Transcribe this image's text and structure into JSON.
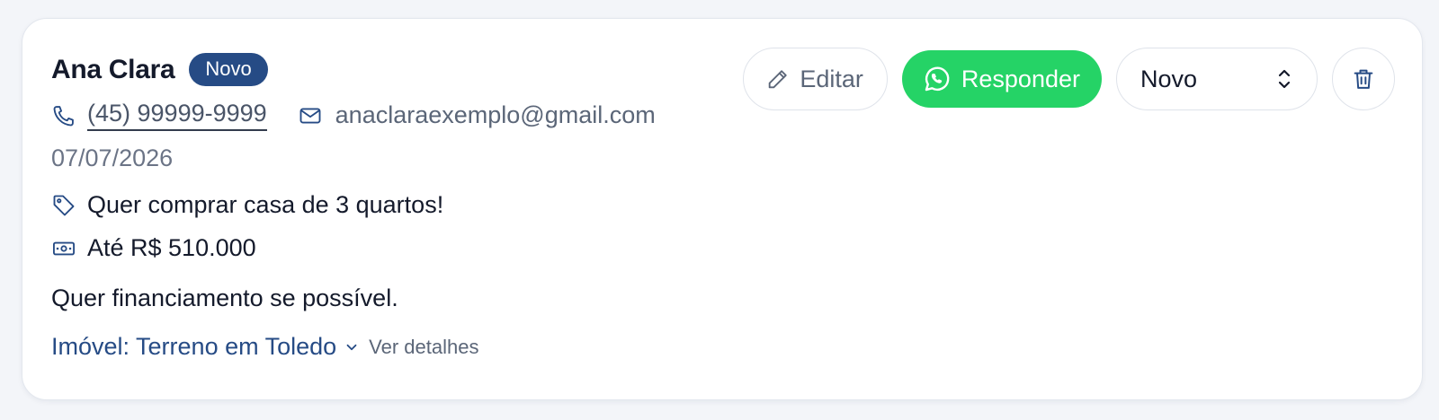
{
  "lead": {
    "name": "Ana Clara",
    "badge": "Novo",
    "phone": "(45) 99999-9999",
    "email": "anaclaraexemplo@gmail.com",
    "date": "07/07/2026",
    "interest": "Quer comprar casa de 3 quartos!",
    "budget": "Até R$ 510.000",
    "notes": "Quer financiamento se possível.",
    "property": "Imóvel: Terreno em Toledo",
    "details_label": "Ver detalhes"
  },
  "actions": {
    "edit_label": "Editar",
    "reply_label": "Responder",
    "status_value": "Novo"
  },
  "icons": {
    "phone": "phone-icon",
    "email": "mail-icon",
    "tag": "tag-icon",
    "money": "banknote-icon",
    "chevron": "chevron-down-icon",
    "edit": "pencil-icon",
    "reply": "whatsapp-icon",
    "select": "chevron-up-down-icon",
    "delete": "trash-icon"
  },
  "colors": {
    "badge_bg": "#264b85",
    "whatsapp_green": "#25d366",
    "link_blue": "#264b85"
  }
}
